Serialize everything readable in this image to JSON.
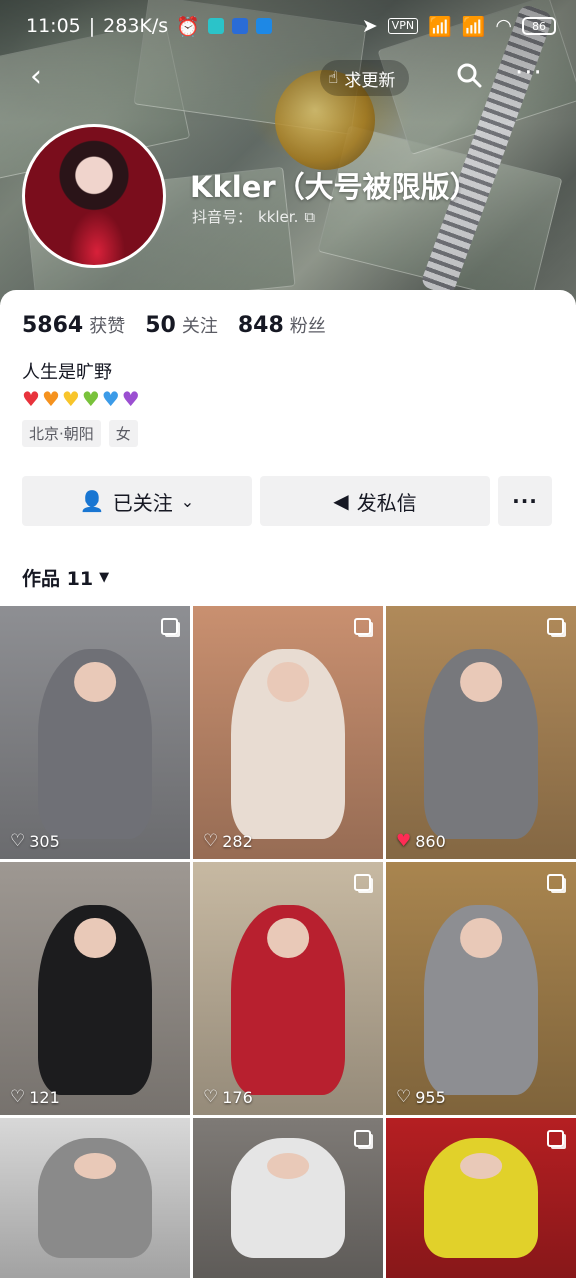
{
  "status_bar": {
    "time": "11:05",
    "speed": "283K/s",
    "vpn": "VPN",
    "battery": "86"
  },
  "nav": {
    "back_icon": "chevron-left-icon",
    "update_label": "求更新",
    "search_icon": "search-icon",
    "more_icon": "more-horizontal-icon"
  },
  "profile": {
    "nickname": "Kkler（大号被限版）",
    "douyin_id_label": "抖音号：",
    "douyin_id": "kkler.",
    "stats": [
      {
        "value": "5864",
        "label": "获赞"
      },
      {
        "value": "50",
        "label": "关注"
      },
      {
        "value": "848",
        "label": "粉丝"
      }
    ],
    "bio": "人生是旷野",
    "heart_colors": [
      "#e8333c",
      "#f5921e",
      "#f8c52b",
      "#79c23b",
      "#3c9be8",
      "#9b4fd1"
    ],
    "tags": [
      "北京·朝阳",
      "女"
    ]
  },
  "actions": {
    "follow_label": "已关注",
    "dm_label": "发私信",
    "more_label": "···"
  },
  "works": {
    "tab_label": "作品 11",
    "items": [
      {
        "likes": "305",
        "liked": false,
        "multi": true,
        "bg": "#8e8f93",
        "fig": "#6f7076"
      },
      {
        "likes": "282",
        "liked": false,
        "multi": true,
        "bg": "#c99070",
        "fig": "#e8dcd2"
      },
      {
        "likes": "860",
        "liked": true,
        "multi": true,
        "bg": "#b08a5a",
        "fig": "#77787c"
      },
      {
        "likes": "121",
        "liked": false,
        "multi": false,
        "bg": "#9e9892",
        "fig": "#1c1c1e"
      },
      {
        "likes": "176",
        "liked": false,
        "multi": true,
        "bg": "#c7b9a2",
        "fig": "#b8202f"
      },
      {
        "likes": "955",
        "liked": false,
        "multi": true,
        "bg": "#a9854f",
        "fig": "#8d8e92"
      },
      {
        "likes": "",
        "liked": false,
        "multi": false,
        "bg": "#d8d8d8",
        "fig": "#8a8a8a"
      },
      {
        "likes": "",
        "liked": false,
        "multi": true,
        "bg": "#7e7a76",
        "fig": "#e5e5e5"
      },
      {
        "likes": "",
        "liked": false,
        "multi": true,
        "bg": "#b51f22",
        "fig": "#e1d12a"
      }
    ]
  }
}
